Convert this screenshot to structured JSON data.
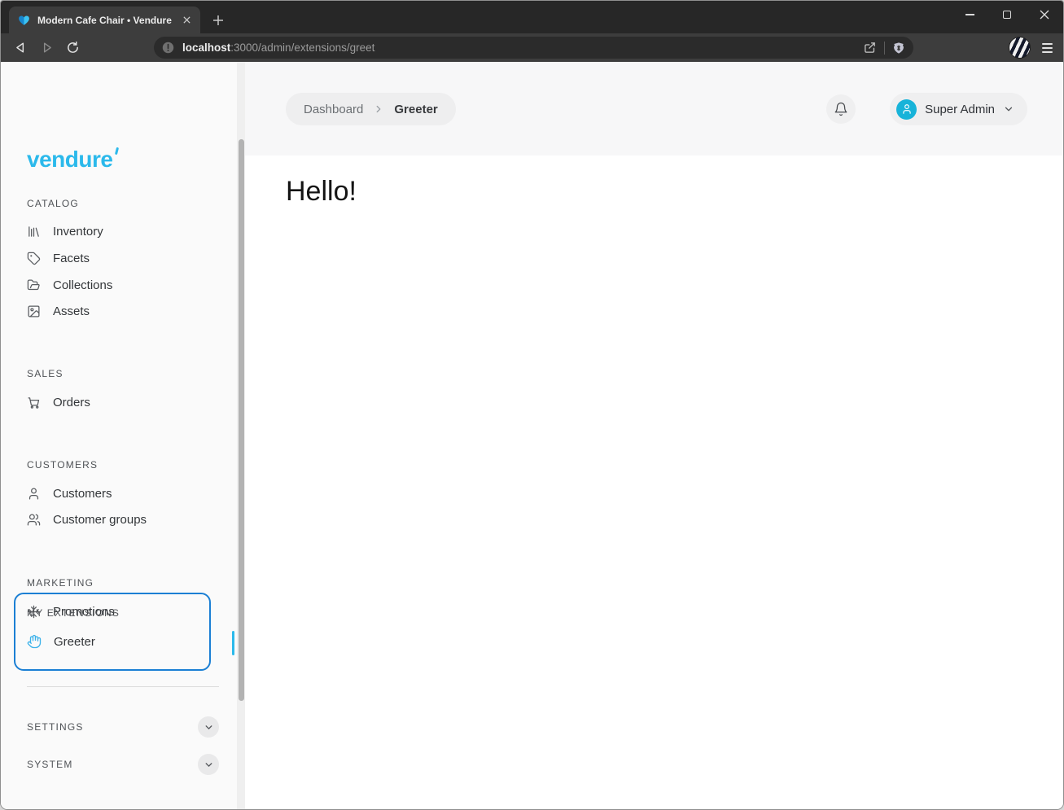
{
  "browser": {
    "tab_title": "Modern Cafe Chair • Vendure",
    "url_host": "localhost",
    "url_path": ":3000/admin/extensions/greet"
  },
  "sidebar": {
    "logo_text": "vendure",
    "sections": [
      {
        "title": "CATALOG",
        "items": [
          {
            "label": "Inventory",
            "icon": "library-icon"
          },
          {
            "label": "Facets",
            "icon": "tag-icon"
          },
          {
            "label": "Collections",
            "icon": "folder-open-icon"
          },
          {
            "label": "Assets",
            "icon": "image-icon"
          }
        ]
      },
      {
        "title": "SALES",
        "items": [
          {
            "label": "Orders",
            "icon": "cart-icon"
          }
        ]
      },
      {
        "title": "CUSTOMERS",
        "items": [
          {
            "label": "Customers",
            "icon": "user-icon"
          },
          {
            "label": "Customer groups",
            "icon": "users-icon"
          }
        ]
      },
      {
        "title": "MARKETING",
        "items": [
          {
            "label": "Promotions",
            "icon": "snowflake-icon"
          }
        ]
      },
      {
        "title": "MY EXTENSIONS",
        "highlighted": true,
        "items": [
          {
            "label": "Greeter",
            "icon": "hand-icon"
          }
        ]
      }
    ],
    "collapsed": [
      {
        "title": "SETTINGS"
      },
      {
        "title": "SYSTEM"
      }
    ]
  },
  "header": {
    "breadcrumb": [
      "Dashboard",
      "Greeter"
    ],
    "user_label": "Super Admin"
  },
  "content": {
    "greeting": "Hello!"
  },
  "colors": {
    "accent": "#2bb9eb",
    "highlight": "#1b7fd4",
    "avatar": "#17b3d9",
    "chrome-dark": "#272727",
    "chrome-mid": "#3d3d3d"
  }
}
